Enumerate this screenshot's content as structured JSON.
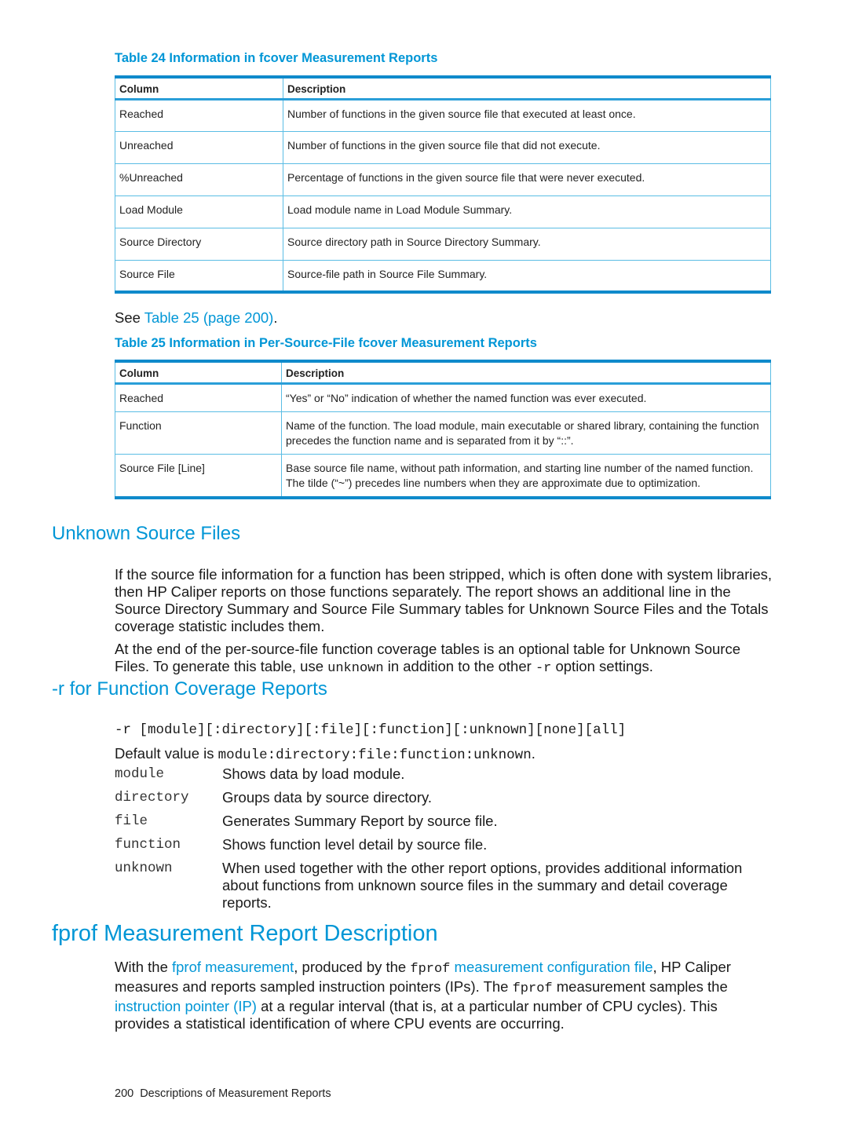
{
  "table24": {
    "caption": "Table 24 Information in fcover Measurement Reports",
    "headers": [
      "Column",
      "Description"
    ],
    "rows": [
      [
        "Reached",
        "Number of functions in the given source file that executed at least once."
      ],
      [
        "Unreached",
        "Number of functions in the given source file that did not execute."
      ],
      [
        "%Unreached",
        "Percentage of functions in the given source file that were never executed."
      ],
      [
        "Load Module",
        "Load module name in Load Module Summary."
      ],
      [
        "Source Directory",
        "Source directory path in Source Directory Summary."
      ],
      [
        "Source File",
        "Source-file path in Source File Summary."
      ]
    ]
  },
  "see_ref": {
    "prefix": "See ",
    "link": "Table 25 (page 200)",
    "suffix": "."
  },
  "table25": {
    "caption": "Table 25 Information in Per-Source-File fcover Measurement Reports",
    "headers": [
      "Column",
      "Description"
    ],
    "rows": [
      [
        "Reached",
        "“Yes” or “No” indication of whether the named function was ever executed."
      ],
      [
        "Function",
        "Name of the function. The load module, main executable or shared library, containing the function precedes the function name and is separated from it by “::”."
      ],
      [
        "Source File [Line]",
        "Base source file name, without path information, and starting line number of the named function. The tilde (“~”) precedes line numbers when they are approximate due to optimization."
      ]
    ]
  },
  "unknown_section": {
    "heading": "Unknown Source Files",
    "para1": "If the source file information for a function has been stripped, which is often done with system libraries, then HP Caliper reports on those functions separately. The report shows an additional line in the Source Directory Summary and Source File Summary tables for Unknown Source Files and the Totals coverage statistic includes them.",
    "para2_a": "At the end of the per-source-file function coverage tables is an optional table for Unknown Source Files. To generate this table, use ",
    "para2_code1": "unknown",
    "para2_b": " in addition to the other ",
    "para2_code2": "-r",
    "para2_c": " option settings."
  },
  "r_section": {
    "heading": "-r for Function Coverage Reports",
    "syntax": "-r [module][:directory][:file][:function][:unknown][none][all]",
    "default_prefix": "Default value is ",
    "default_value": "module:directory:file:function:unknown",
    "default_suffix": ".",
    "options": [
      {
        "term": "module",
        "desc": "Shows data by load module."
      },
      {
        "term": "directory",
        "desc": "Groups data by source directory."
      },
      {
        "term": "file",
        "desc": "Generates Summary Report by source file."
      },
      {
        "term": "function",
        "desc": "Shows function level detail by source file."
      },
      {
        "term": "unknown",
        "desc": "When used together with the other report options, provides additional information about functions from unknown source files in the summary and detail coverage reports."
      }
    ]
  },
  "fprof_section": {
    "heading": "fprof Measurement Report Description",
    "p_a": "With the ",
    "p_link1": "fprof measurement",
    "p_b": ", produced by the ",
    "p_code1": "fprof",
    "p_c": " ",
    "p_link2": "measurement configuration file",
    "p_d": ", HP Caliper measures and reports sampled instruction pointers (IPs). The ",
    "p_code2": "fprof",
    "p_e": " measurement samples the ",
    "p_link3": "instruction pointer (IP)",
    "p_f": " at a regular interval (that is, at a particular number of CPU cycles). This provides a statistical identification of where CPU events are occurring."
  },
  "footer": {
    "page_number": "200",
    "chapter_title": "Descriptions of Measurement Reports"
  },
  "colors": {
    "accent": "#0096d6",
    "table_border": "#0f8acb",
    "table_inner_border": "#5bbde4",
    "text": "#1a1a1a"
  }
}
